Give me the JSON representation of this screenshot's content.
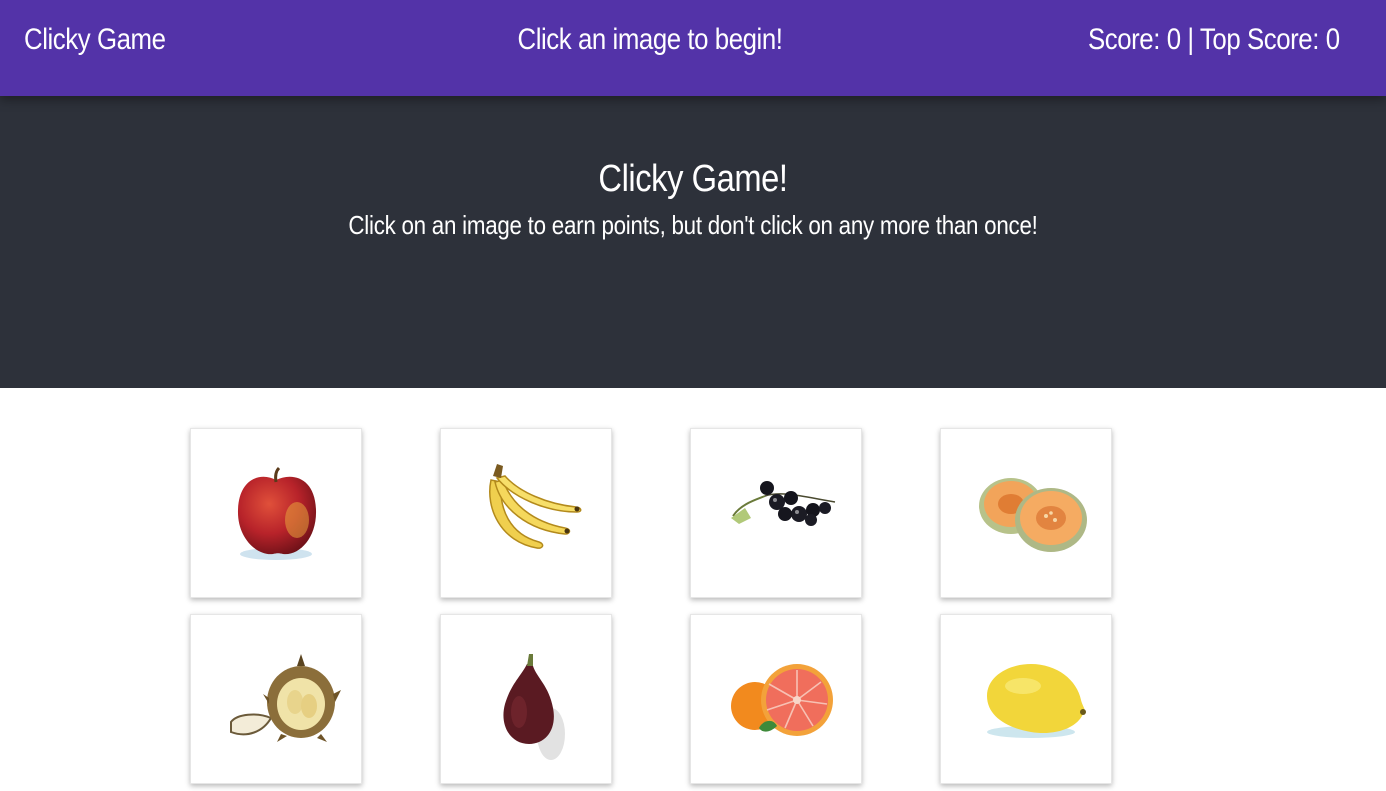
{
  "navbar": {
    "brand": "Clicky Game",
    "message": "Click an image to begin!",
    "score_label": "Score:",
    "score": 0,
    "top_score_label": "Top Score:",
    "top_score": 0,
    "background": "#5333a8"
  },
  "hero": {
    "title": "Clicky Game!",
    "subtitle": "Click on an image to earn points, but don't click on any more than once!",
    "background": "#2d313a"
  },
  "cards": [
    {
      "icon": "apple-icon"
    },
    {
      "icon": "banana-icon"
    },
    {
      "icon": "blackcurrant-icon"
    },
    {
      "icon": "cantaloupe-icon"
    },
    {
      "icon": "durian-icon"
    },
    {
      "icon": "fig-icon"
    },
    {
      "icon": "grapefruit-icon"
    },
    {
      "icon": "lemon-icon"
    }
  ]
}
